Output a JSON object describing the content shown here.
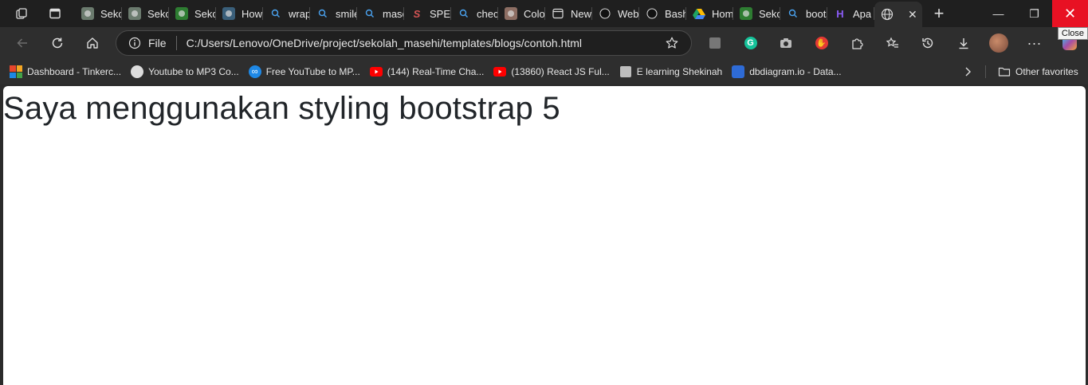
{
  "tabs": [
    {
      "label": "Sekolah",
      "icon": "favicon-sekolah-1",
      "color": "#6b7b6e"
    },
    {
      "label": "Sekolah",
      "icon": "favicon-sekolah-2",
      "color": "#6b7b6e"
    },
    {
      "label": "Sekolah",
      "icon": "favicon-sekolah-3",
      "color": "#2e7d32"
    },
    {
      "label": "How",
      "icon": "favicon-w3",
      "color": "#3a5f7a"
    },
    {
      "label": "wrap",
      "icon": "search-icon",
      "color": "#1f1f1f"
    },
    {
      "label": "smile",
      "icon": "search-icon",
      "color": "#1f1f1f"
    },
    {
      "label": "masehi",
      "icon": "search-icon",
      "color": "#1f1f1f"
    },
    {
      "label": "SPEM",
      "icon": "favicon-spem",
      "color": "#c0392b"
    },
    {
      "label": "check",
      "icon": "search-icon",
      "color": "#1f1f1f"
    },
    {
      "label": "Color",
      "icon": "favicon-color",
      "color": "#8d6e63"
    },
    {
      "label": "New",
      "icon": "favicon-newtab",
      "color": "#1f1f1f"
    },
    {
      "label": "Web",
      "icon": "favicon-github",
      "color": "#1f1f1f"
    },
    {
      "label": "Bash",
      "icon": "favicon-github",
      "color": "#1f1f1f"
    },
    {
      "label": "Home",
      "icon": "favicon-google-drive",
      "color": "#1f1f1f"
    },
    {
      "label": "Sekolah",
      "icon": "favicon-sekolah-4",
      "color": "#2e7d32"
    },
    {
      "label": "boots",
      "icon": "search-icon",
      "color": "#1f1f1f"
    },
    {
      "label": "Apa",
      "icon": "favicon-hashnode",
      "color": "#7b4bd6"
    }
  ],
  "active_tab": {
    "icon": "globe-icon",
    "close": "✕"
  },
  "new_tab_symbol": "+",
  "window": {
    "minimize": "—",
    "restore": "❐",
    "close": "✕",
    "close_tooltip": "Close"
  },
  "address": {
    "scheme_label": "File",
    "url": "C:/Users/Lenovo/OneDrive/project/sekolah_masehi/templates/blogs/contoh.html"
  },
  "bookmarks": [
    {
      "label": "Dashboard - Tinkerc...",
      "icon": "tinkercad-icon",
      "color": "#e7462c"
    },
    {
      "label": "Youtube to MP3 Co...",
      "icon": "audio-wave-icon",
      "color": "#dddddd"
    },
    {
      "label": "Free YouTube to MP...",
      "icon": "infinity-icon",
      "color": "#1e88e5"
    },
    {
      "label": "(144) Real-Time Cha...",
      "icon": "youtube-icon",
      "color": "#ff0000"
    },
    {
      "label": "(13860) React JS Ful...",
      "icon": "youtube-icon",
      "color": "#ff0000"
    },
    {
      "label": "E learning Shekinah",
      "icon": "elearning-icon",
      "color": "#bdbdbd"
    },
    {
      "label": "dbdiagram.io - Data...",
      "icon": "dbdiagram-icon",
      "color": "#2e6bd6"
    }
  ],
  "other_favorites": "Other favorites",
  "page": {
    "heading": "Saya menggunakan styling bootstrap 5"
  }
}
